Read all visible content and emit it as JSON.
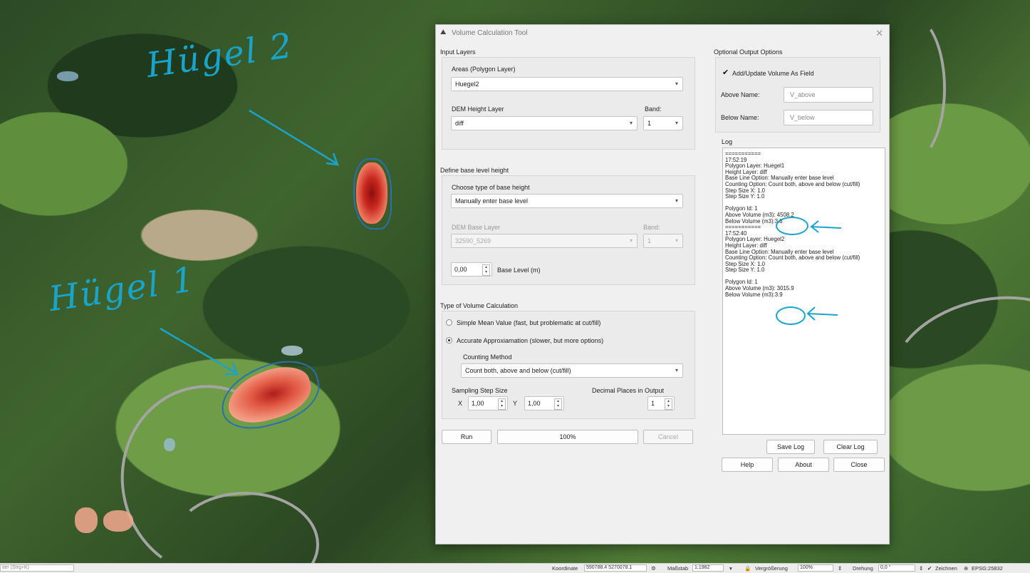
{
  "map": {
    "annotation_hill2": "Hügel 2",
    "annotation_hill1": "Hügel 1"
  },
  "dialog": {
    "title": "Volume Calculation Tool",
    "input_layers": {
      "title": "Input Layers",
      "areas_label": "Areas (Polygon Layer)",
      "areas_value": "Huegel2",
      "dem_label": "DEM Height Layer",
      "dem_value": "diff",
      "band_label": "Band:",
      "band_value": "1"
    },
    "base_level": {
      "title": "Define base level height",
      "type_label": "Choose type of base height",
      "type_value": "Manually enter base level",
      "dem_base_label": "DEM Base Layer",
      "dem_base_value": "32590_5269",
      "band_label": "Band:",
      "band_value": "1",
      "base_value": "0,00",
      "base_label": "Base Level (m)"
    },
    "volume_calc": {
      "title": "Type of Volume Calculation",
      "simple_label": "Simple Mean Value  (fast, but problematic at cut/fill)",
      "accurate_label": "Accurate Approxiamation (slower, but more options)",
      "counting_label": "Counting Method",
      "counting_value": "Count both, above and below (cut/fill)",
      "sampling_label": "Sampling Step Size",
      "x_label": "X",
      "x_value": "1,00",
      "y_label": "Y",
      "y_value": "1,00",
      "decimal_label": "Decimal Places in Output",
      "decimal_value": "1"
    },
    "run_label": "Run",
    "progress_text": "100%",
    "progress_value": 1.0,
    "cancel_label": "Cancel",
    "output_options": {
      "title": "Optional Output Options",
      "add_field_label": "Add/Update Volume As Field",
      "above_name_label": "Above Name:",
      "above_name_value": "V_above",
      "below_name_label": "Below Name:",
      "below_name_value": "V_below"
    },
    "log_label": "Log",
    "log_lines": [
      "===========",
      "17:52:19",
      "Polygon Layer: Huegel1",
      "Height Layer: diff",
      "Base Line Option: Manually enter base level",
      "Counting Option: Count both, above and below (cut/fill)",
      "Step Size X: 1.0",
      "Step Size Y: 1.0",
      "",
      "Polygon Id: 1",
      "Above Volume (m3): 4508.2",
      "Below Volume (m3):3.8",
      "===========",
      "17:52:40",
      "Polygon Layer: Huegel2",
      "Height Layer: diff",
      "Base Line Option: Manually enter base level",
      "Counting Option: Count both, above and below (cut/fill)",
      "Step Size X: 1.0",
      "Step Size Y: 1.0",
      "",
      "Polygon Id: 1",
      "Above Volume (m3): 3015.9",
      "Below Volume (m3):3.9"
    ],
    "save_log_label": "Save Log",
    "clear_log_label": "Clear Log",
    "help_label": "Help",
    "about_label": "About",
    "close_label": "Close"
  },
  "statusbar": {
    "search_placeholder": "iter (Strg+K)",
    "coord_label": "Koordinate",
    "coord_value": "590788.4 5270078.1",
    "scale_label": "Maßstab",
    "scale_value": "1:1982",
    "zoom_label": "Vergrößerung",
    "zoom_value": "100%",
    "rotation_label": "Drehung",
    "rotation_value": "0,0 °",
    "render_label": "Zeichnen",
    "crs_label": "EPSG:25832"
  }
}
